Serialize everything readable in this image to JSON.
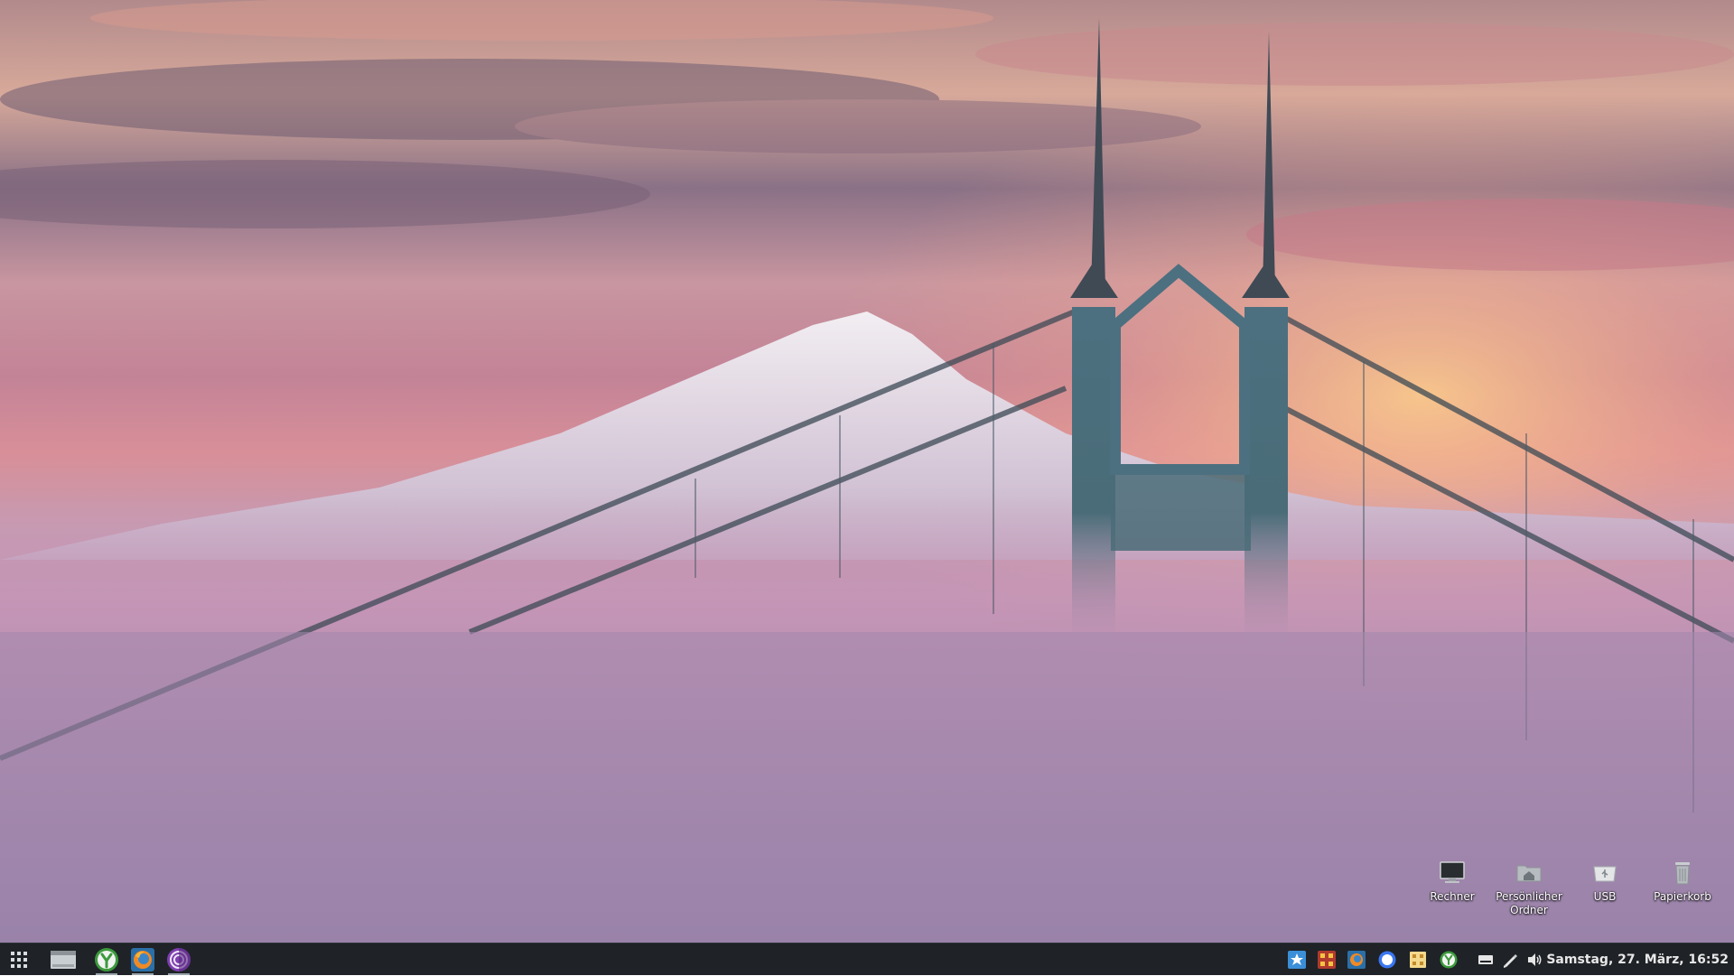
{
  "desktop": {
    "icons": [
      {
        "label": "Rechner",
        "icon": "computer-icon"
      },
      {
        "label": "Persönlicher Ordner",
        "icon": "home-folder-icon"
      },
      {
        "label": "USB",
        "icon": "usb-drive-icon"
      },
      {
        "label": "Papierkorb",
        "icon": "trash-icon"
      }
    ]
  },
  "taskbar": {
    "launchers": [
      {
        "name": "app-menu",
        "icon": "app-grid-icon"
      },
      {
        "name": "show-desktop",
        "icon": "show-desktop-icon"
      },
      {
        "name": "green-app",
        "icon": "green-y-icon"
      },
      {
        "name": "firefox",
        "icon": "firefox-icon"
      },
      {
        "name": "tor-browser",
        "icon": "tor-browser-icon"
      }
    ],
    "tray": [
      {
        "icon": "blue-star-icon"
      },
      {
        "icon": "red-grid-icon"
      },
      {
        "icon": "firefox-tray-icon"
      },
      {
        "icon": "signal-icon"
      },
      {
        "icon": "notes-icon"
      },
      {
        "icon": "green-y-tray-icon"
      },
      {
        "icon": "keyboard-icon"
      },
      {
        "icon": "pen-icon"
      },
      {
        "icon": "volume-icon"
      }
    ],
    "clock": "Samstag, 27. März, 16:52"
  },
  "colors": {
    "taskbar_bg": "#1f2327",
    "sky_top": "#6b5a78",
    "fog": "#b08fb0",
    "bridge": "#4f7580"
  }
}
